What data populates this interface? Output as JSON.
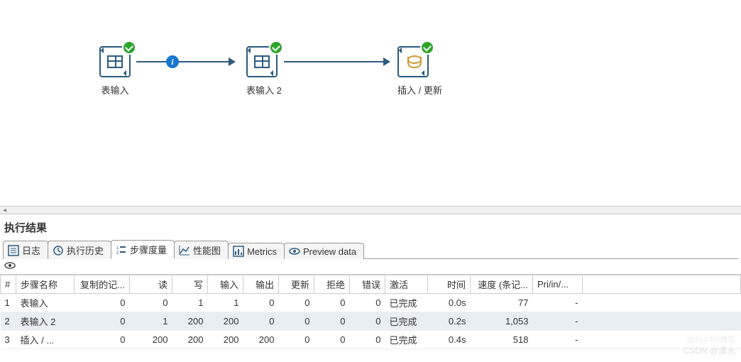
{
  "canvas": {
    "nodes": [
      {
        "label": "表输入",
        "type": "table"
      },
      {
        "label": "表输入 2",
        "type": "table"
      },
      {
        "label": "插入 / 更新",
        "type": "database"
      }
    ]
  },
  "results": {
    "title": "执行结果",
    "tabs": [
      {
        "label": "日志"
      },
      {
        "label": "执行历史"
      },
      {
        "label": "步骤度量"
      },
      {
        "label": "性能图"
      },
      {
        "label": "Metrics"
      },
      {
        "label": "Preview data"
      }
    ],
    "columns": [
      "#",
      "步骤名称",
      "复制的记...",
      "读",
      "写",
      "输入",
      "输出",
      "更新",
      "拒绝",
      "错误",
      "激活",
      "时间",
      "速度 (条记...",
      "Pri/in/..."
    ],
    "rows": [
      {
        "n": "1",
        "name": "表输入",
        "copy": "0",
        "read": "0",
        "write": "1",
        "in": "1",
        "out": "0",
        "upd": "0",
        "rej": "0",
        "err": "0",
        "act": "已完成",
        "time": "0.0s",
        "speed": "77",
        "pri": "-"
      },
      {
        "n": "2",
        "name": "表输入 2",
        "copy": "0",
        "read": "1",
        "write": "200",
        "in": "200",
        "out": "0",
        "upd": "0",
        "rej": "0",
        "err": "0",
        "act": "已完成",
        "time": "0.2s",
        "speed": "1,053",
        "pri": "-"
      },
      {
        "n": "3",
        "name": "插入 / ...",
        "copy": "0",
        "read": "200",
        "write": "200",
        "in": "200",
        "out": "200",
        "upd": "0",
        "rej": "0",
        "err": "0",
        "act": "已完成",
        "time": "0.4s",
        "speed": "518",
        "pri": "-"
      }
    ]
  },
  "watermarks": {
    "w1": "@51CTO博客",
    "w2": "CSDN @清水"
  }
}
